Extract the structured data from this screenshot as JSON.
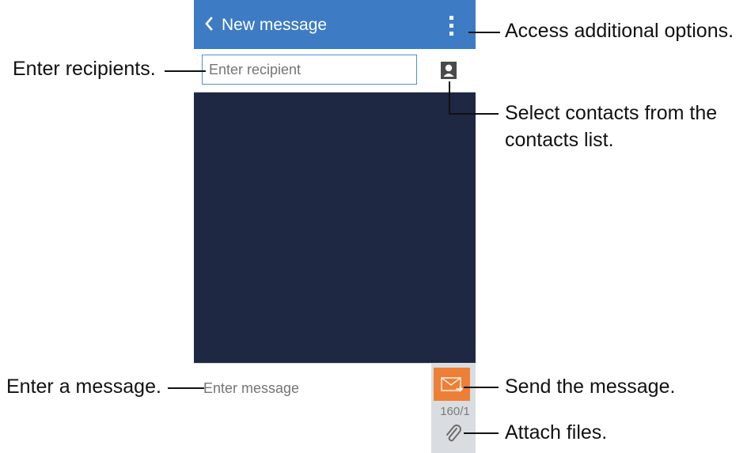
{
  "app": {
    "title": "New message",
    "back_icon": "chevron-left-icon",
    "menu_icon": "more-vertical-icon"
  },
  "recipient": {
    "placeholder": "Enter recipient",
    "contacts_icon": "contact-book-icon"
  },
  "composer": {
    "placeholder": "Enter message",
    "counter": "160/1",
    "send_icon": "envelope-send-icon",
    "attach_icon": "paperclip-icon"
  },
  "callouts": {
    "options": "Access additional options.",
    "recipients": "Enter recipients.",
    "contacts_line1": "Select contacts from the",
    "contacts_line2": "contacts list.",
    "message": "Enter a message.",
    "send": "Send the message.",
    "attach": "Attach files."
  },
  "colors": {
    "action_bar": "#3d7cc4",
    "conversation_bg": "#1e2843",
    "send_button": "#ee7f36",
    "input_border": "#4f8fd6"
  }
}
